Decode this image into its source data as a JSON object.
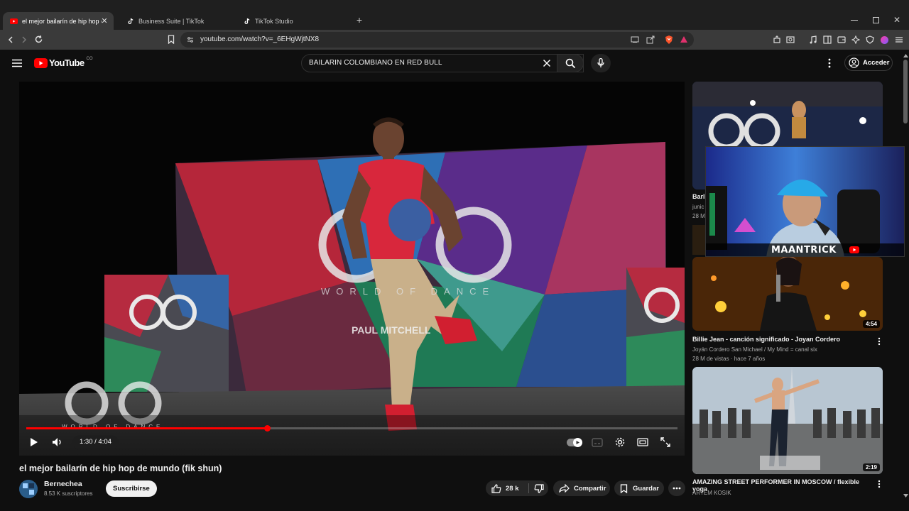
{
  "browser": {
    "tabs": [
      {
        "title": "el mejor bailarín de hip hop de m",
        "active": true
      },
      {
        "title": "Business Suite | TikTok",
        "active": false
      },
      {
        "title": "TikTok Studio",
        "active": false
      }
    ],
    "url": "youtube.com/watch?v=_6EHgWjtNX8"
  },
  "youtube": {
    "logo_text": "YouTube",
    "country_code": "CO",
    "search_query": "BAILARIN COLOMBIANO EN RED BULL",
    "signin_label": "Acceder"
  },
  "player": {
    "time": "1:30 / 4:04",
    "progress": 0.37,
    "backdrop_big": "WOD",
    "backdrop_sub": "WORLD OF DANCE",
    "banner_text": "PAUL MITCHELL",
    "watermark": "WOD",
    "watermark_sub": "WORLD OF DANCE"
  },
  "video": {
    "title": "el mejor bailarín de hip hop de mundo (fik shun)",
    "channel": "Bernechea",
    "subscribers": "8.53 K suscriptores",
    "subscribe_label": "Suscribirse",
    "likes": "28 k",
    "share_label": "Compartir",
    "save_label": "Guardar"
  },
  "overlay": {
    "streamer": "MAANTRICK"
  },
  "sidebar": {
    "items": [
      {
        "title": "Barl",
        "channel": "junic",
        "stats": "28 M",
        "duration": ""
      },
      {
        "title": "Billie Jean - canción significado - Joyan Cordero",
        "channel": "Joyán Cordero San Michael / My Mind = canal six",
        "stats": "28 M de vistas · hace 7 años",
        "duration": "4:54"
      },
      {
        "title": "AMAZING STREET PERFORMER IN MOSCOW / flexible yoga",
        "channel": "ARTEM KOSIK",
        "stats": "",
        "duration": "2:19"
      }
    ]
  },
  "colors": {
    "accent": "#ff0000",
    "background": "#0f0f0f"
  }
}
